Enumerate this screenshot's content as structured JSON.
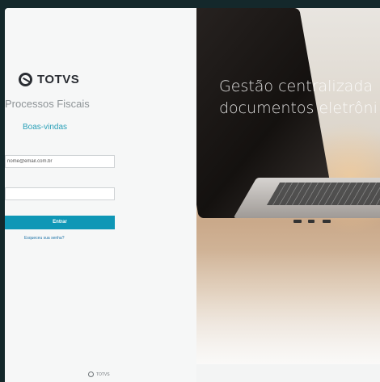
{
  "brand": {
    "name": "TOTVS",
    "footer_name": "TOTVS"
  },
  "app": {
    "title": "Processos Fiscais",
    "welcome": "Boas-vindas"
  },
  "login": {
    "email_value": "nome@email.com.br",
    "email_label": "",
    "password_label": "",
    "submit_label": "Entrar",
    "forgot_label": "Esqueceu sua senha?"
  },
  "hero": {
    "line1": "Gestão centralizada",
    "line2": "documentos eletrôni"
  },
  "colors": {
    "accent": "#0f97b6",
    "link": "#1e73a8",
    "welcome": "#2aa0b8"
  }
}
